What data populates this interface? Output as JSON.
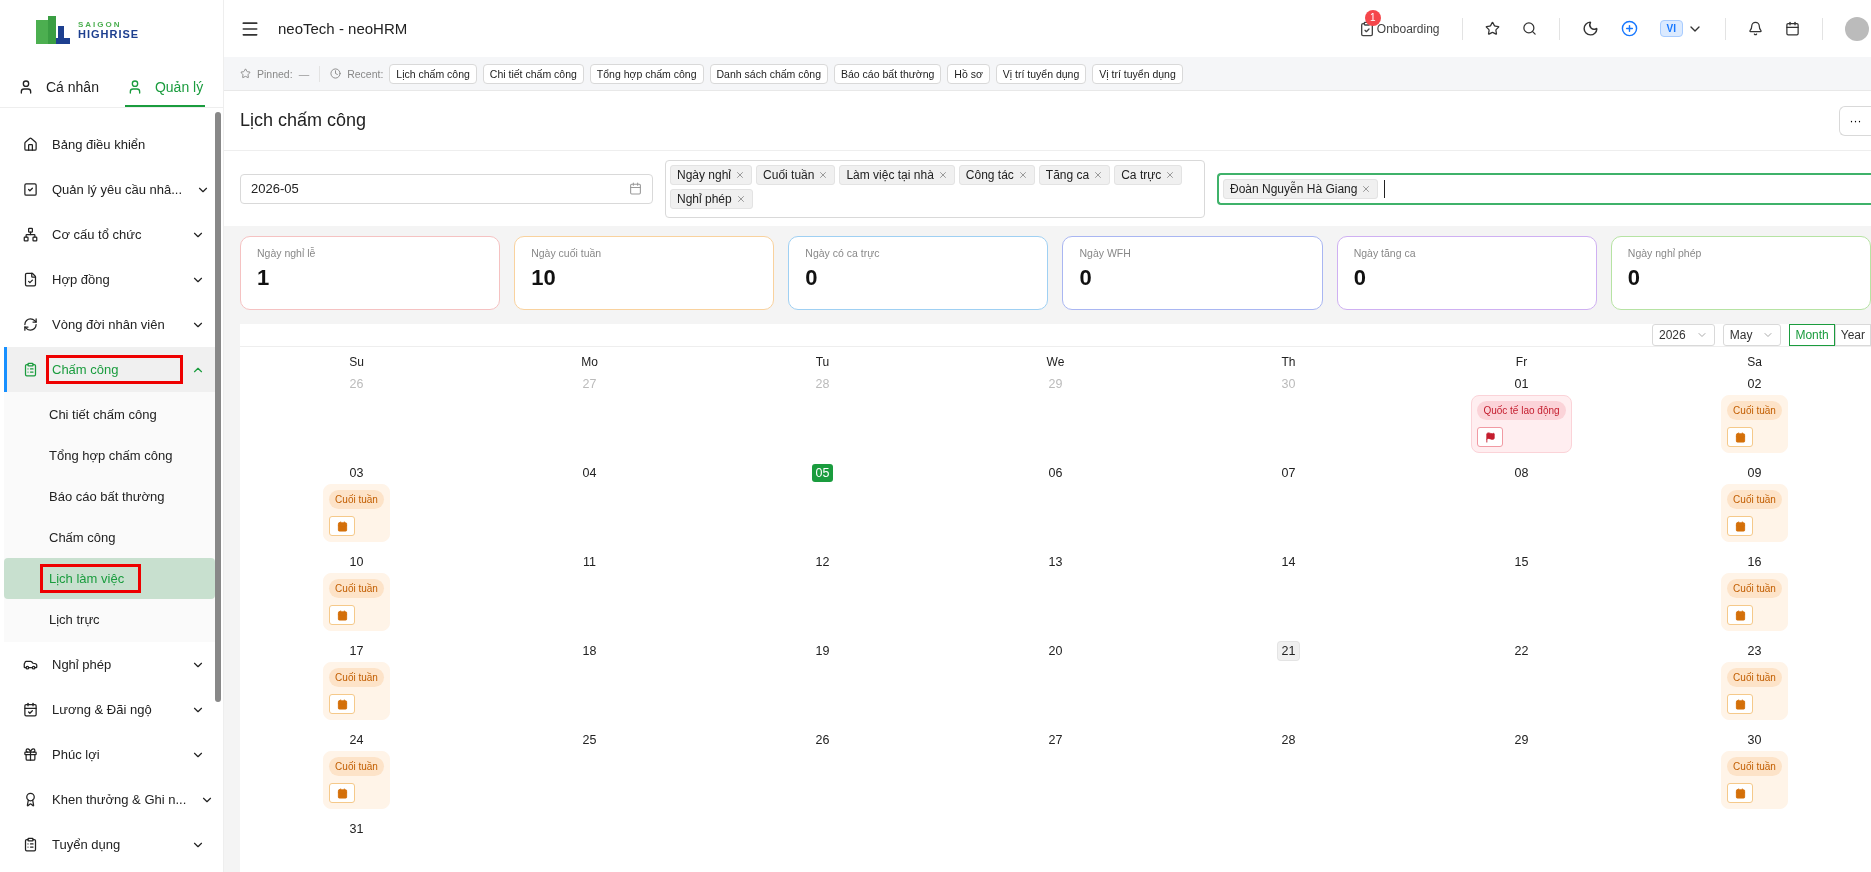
{
  "sidebar": {
    "logo": {
      "line1": "SAIGON",
      "line2": "HIGHRISE"
    },
    "tabs": [
      {
        "label": "Cá nhân",
        "selected": false
      },
      {
        "label": "Quản lý",
        "selected": true
      }
    ],
    "items": [
      {
        "kind": "link",
        "label": "Bảng điều khiển",
        "selected": false,
        "annotated": false
      },
      {
        "kind": "group",
        "label": "Quản lý yêu cầu nhâ...",
        "expanded": false,
        "selected": false,
        "annotated": false
      },
      {
        "kind": "group",
        "label": "Cơ cấu tổ chức",
        "expanded": false,
        "selected": false,
        "annotated": false
      },
      {
        "kind": "group",
        "label": "Hợp đồng",
        "expanded": false,
        "selected": false,
        "annotated": false
      },
      {
        "kind": "group",
        "label": "Vòng đời nhân viên",
        "expanded": false,
        "selected": false,
        "annotated": false
      },
      {
        "kind": "group",
        "label": "Chấm công",
        "expanded": true,
        "selected": true,
        "annotated": true,
        "children": [
          {
            "label": "Chi tiết chấm công",
            "selected": false,
            "annotated": false
          },
          {
            "label": "Tổng hợp chấm công",
            "selected": false,
            "annotated": false
          },
          {
            "label": "Báo cáo bất thường",
            "selected": false,
            "annotated": false
          },
          {
            "label": "Chấm công",
            "selected": false,
            "annotated": false
          },
          {
            "label": "Lịch làm việc",
            "selected": true,
            "annotated": true
          },
          {
            "label": "Lịch trực",
            "selected": false,
            "annotated": false
          }
        ]
      },
      {
        "kind": "group",
        "label": "Nghỉ phép",
        "expanded": false,
        "selected": false,
        "annotated": false
      },
      {
        "kind": "group",
        "label": "Lương & Đãi ngộ",
        "expanded": false,
        "selected": false,
        "annotated": false
      },
      {
        "kind": "group",
        "label": "Phúc lợi",
        "expanded": false,
        "selected": false,
        "annotated": false
      },
      {
        "kind": "group",
        "label": "Khen thưởng & Ghi n...",
        "expanded": false,
        "selected": false,
        "annotated": false
      },
      {
        "kind": "group",
        "label": "Tuyển dụng",
        "expanded": false,
        "selected": false,
        "annotated": false
      }
    ]
  },
  "header": {
    "title": "neoTech - neoHRM",
    "onboarding": {
      "label": "Onboarding",
      "badge": "1"
    },
    "language": "VI"
  },
  "recent_bar": {
    "pinned_label": "Pinned:",
    "pinned_value": "—",
    "recent_label": "Recent:",
    "chips": [
      "Lịch chấm công",
      "Chi tiết chấm công",
      "Tổng hợp chấm công",
      "Danh sách chấm công",
      "Báo cáo bất thường",
      "Hồ sơ",
      "Vị trí tuyển dụng",
      "Vị trí tuyển dụng"
    ]
  },
  "page": {
    "title": "Lịch chấm công",
    "more_button": "···"
  },
  "filters": {
    "month": "2026-05",
    "types": [
      "Ngày nghỉ",
      "Cuối tuần",
      "Làm việc tại nhà",
      "Công tác",
      "Tăng ca",
      "Ca trực",
      "Nghỉ phép"
    ],
    "employees": [
      "Đoàn Nguyễn Hà Giang"
    ]
  },
  "stats": [
    {
      "label": "Ngày nghỉ lễ",
      "value": "1",
      "color": "#f5c2c2"
    },
    {
      "label": "Ngày cuối tuần",
      "value": "10",
      "color": "#f9d29e"
    },
    {
      "label": "Ngày có ca trực",
      "value": "0",
      "color": "#9fd0f3"
    },
    {
      "label": "Ngày WFH",
      "value": "0",
      "color": "#a9b6f2"
    },
    {
      "label": "Ngày tăng ca",
      "value": "0",
      "color": "#cfb0f2"
    },
    {
      "label": "Ngày nghỉ phép",
      "value": "0",
      "color": "#b6e3a3"
    }
  ],
  "calendar": {
    "year": "2026",
    "month": "May",
    "views": [
      {
        "label": "Month",
        "selected": true
      },
      {
        "label": "Year",
        "selected": false
      }
    ],
    "weekdays": [
      "Su",
      "Mo",
      "Tu",
      "We",
      "Th",
      "Fr",
      "Sa"
    ],
    "weeks": [
      [
        {
          "day": "26",
          "muted": true,
          "today": false,
          "selected": false
        },
        {
          "day": "27",
          "muted": true,
          "today": false,
          "selected": false
        },
        {
          "day": "28",
          "muted": true,
          "today": false,
          "selected": false
        },
        {
          "day": "29",
          "muted": true,
          "today": false,
          "selected": false
        },
        {
          "day": "30",
          "muted": true,
          "today": false,
          "selected": false
        },
        {
          "day": "01",
          "muted": false,
          "today": false,
          "selected": false,
          "events": [
            {
              "kind": "holiday",
              "label": "Quốc tế lao động"
            }
          ]
        },
        {
          "day": "02",
          "muted": false,
          "today": false,
          "selected": false,
          "events": [
            {
              "kind": "weekend",
              "label": "Cuối tuần"
            }
          ]
        }
      ],
      [
        {
          "day": "03",
          "muted": false,
          "today": false,
          "selected": false,
          "events": [
            {
              "kind": "weekend",
              "label": "Cuối tuần"
            }
          ]
        },
        {
          "day": "04",
          "muted": false,
          "today": false,
          "selected": false
        },
        {
          "day": "05",
          "muted": false,
          "today": true,
          "selected": false
        },
        {
          "day": "06",
          "muted": false,
          "today": false,
          "selected": false
        },
        {
          "day": "07",
          "muted": false,
          "today": false,
          "selected": false
        },
        {
          "day": "08",
          "muted": false,
          "today": false,
          "selected": false
        },
        {
          "day": "09",
          "muted": false,
          "today": false,
          "selected": false,
          "events": [
            {
              "kind": "weekend",
              "label": "Cuối tuần"
            }
          ]
        }
      ],
      [
        {
          "day": "10",
          "muted": false,
          "today": false,
          "selected": false,
          "events": [
            {
              "kind": "weekend",
              "label": "Cuối tuần"
            }
          ]
        },
        {
          "day": "11",
          "muted": false,
          "today": false,
          "selected": false
        },
        {
          "day": "12",
          "muted": false,
          "today": false,
          "selected": false
        },
        {
          "day": "13",
          "muted": false,
          "today": false,
          "selected": false
        },
        {
          "day": "14",
          "muted": false,
          "today": false,
          "selected": false
        },
        {
          "day": "15",
          "muted": false,
          "today": false,
          "selected": false
        },
        {
          "day": "16",
          "muted": false,
          "today": false,
          "selected": false,
          "events": [
            {
              "kind": "weekend",
              "label": "Cuối tuần"
            }
          ]
        }
      ],
      [
        {
          "day": "17",
          "muted": false,
          "today": false,
          "selected": false,
          "events": [
            {
              "kind": "weekend",
              "label": "Cuối tuần"
            }
          ]
        },
        {
          "day": "18",
          "muted": false,
          "today": false,
          "selected": false
        },
        {
          "day": "19",
          "muted": false,
          "today": false,
          "selected": false
        },
        {
          "day": "20",
          "muted": false,
          "today": false,
          "selected": false
        },
        {
          "day": "21",
          "muted": false,
          "today": false,
          "selected": true
        },
        {
          "day": "22",
          "muted": false,
          "today": false,
          "selected": false
        },
        {
          "day": "23",
          "muted": false,
          "today": false,
          "selected": false,
          "events": [
            {
              "kind": "weekend",
              "label": "Cuối tuần"
            }
          ]
        }
      ],
      [
        {
          "day": "24",
          "muted": false,
          "today": false,
          "selected": false,
          "events": [
            {
              "kind": "weekend",
              "label": "Cuối tuần"
            }
          ]
        },
        {
          "day": "25",
          "muted": false,
          "today": false,
          "selected": false
        },
        {
          "day": "26",
          "muted": false,
          "today": false,
          "selected": false
        },
        {
          "day": "27",
          "muted": false,
          "today": false,
          "selected": false
        },
        {
          "day": "28",
          "muted": false,
          "today": false,
          "selected": false
        },
        {
          "day": "29",
          "muted": false,
          "today": false,
          "selected": false
        },
        {
          "day": "30",
          "muted": false,
          "today": false,
          "selected": false,
          "events": [
            {
              "kind": "weekend",
              "label": "Cuối tuần"
            }
          ]
        }
      ],
      [
        {
          "day": "31",
          "muted": false,
          "today": false,
          "selected": false
        }
      ]
    ]
  }
}
